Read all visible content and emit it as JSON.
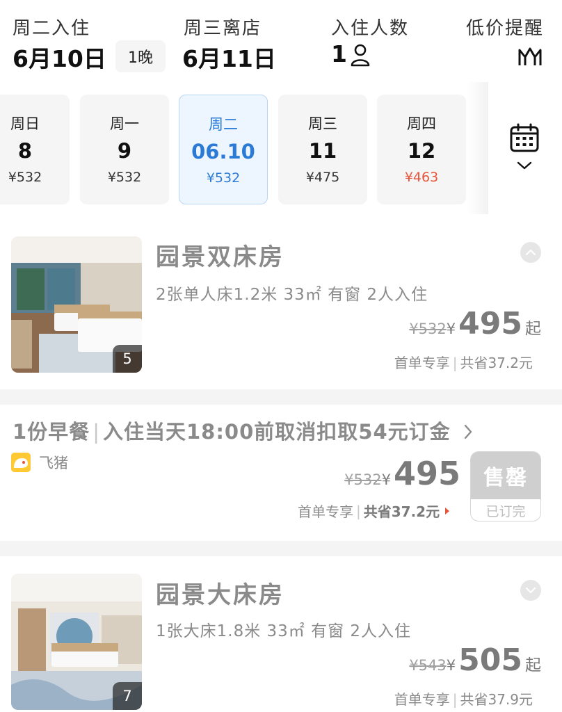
{
  "header": {
    "checkin_label": "周二入住",
    "checkin_date": "6月10日",
    "nights": "1晚",
    "checkout_label": "周三离店",
    "checkout_date": "6月11日",
    "guests_label": "入住人数",
    "guests_count": "1",
    "guests_icon": "person-icon",
    "price_alert_label": "低价提醒",
    "price_alert_icon": "price-alert-icon"
  },
  "date_strip": {
    "days": [
      {
        "weekday": "周日",
        "day": "8",
        "price": "¥532"
      },
      {
        "weekday": "周一",
        "day": "9",
        "price": "¥532"
      },
      {
        "weekday": "周二",
        "day": "06.10",
        "price": "¥532",
        "selected": true
      },
      {
        "weekday": "周三",
        "day": "11",
        "price": "¥475"
      },
      {
        "weekday": "周四",
        "day": "12",
        "price": "¥463",
        "lowest": true
      }
    ],
    "calendar_icon": "calendar-icon"
  },
  "rooms": [
    {
      "name": "园景双床房",
      "specs": "2张单人床1.2米  33㎡  有窗  2人入住",
      "photo_count": "5",
      "original_price": "¥532",
      "currency": "¥",
      "price": "495",
      "price_suffix": "起",
      "promo_tag": "首单专享",
      "savings": "共省37.2元",
      "toggle_icon": "chevron-up-icon"
    },
    {
      "name": "园景大床房",
      "specs": "1张大床1.8米  33㎡  有窗  2人入住",
      "photo_count": "7",
      "original_price": "¥543",
      "currency": "¥",
      "price": "505",
      "price_suffix": "起",
      "promo_tag": "首单专享",
      "savings": "共省37.9元",
      "toggle_icon": "chevron-down-icon"
    }
  ],
  "rate_plan": {
    "breakfast": "1份早餐",
    "cancel_policy": "入住当天18:00前取消扣取54元订金",
    "vendor": "飞猪",
    "original_price": "¥532",
    "currency": "¥",
    "price": "495",
    "promo_tag": "首单专享",
    "savings": "共省37.2元",
    "soldout_label": "售罄",
    "booked_label": "已订完"
  },
  "colors": {
    "accent_blue": "#2b7ad6",
    "lowest_price_red": "#e8543a",
    "muted_text": "#8a8a8a",
    "vendor_yellow": "#ffc933"
  }
}
